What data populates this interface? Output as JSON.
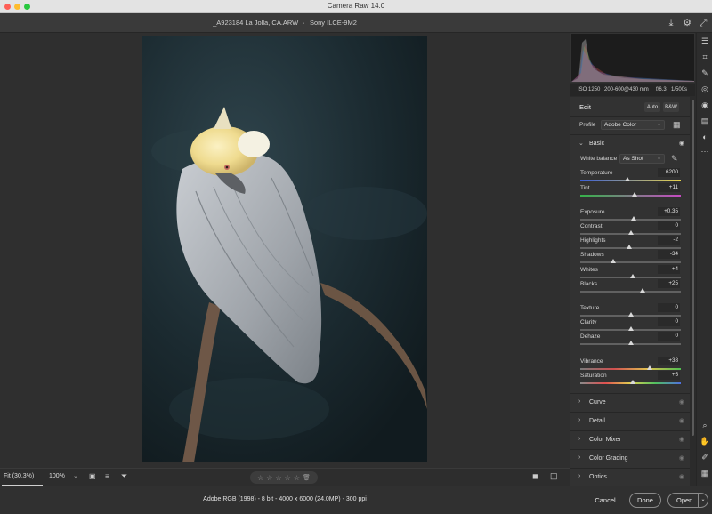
{
  "window": {
    "title": "Camera Raw 14.0"
  },
  "file": {
    "name": "_A923184 La Jolla, CA.ARW",
    "separator": "·",
    "camera": "Sony ILCE-9M2"
  },
  "histogram": {
    "colors": [
      "#e05050",
      "#50c070",
      "#5070e0"
    ]
  },
  "camera_info": {
    "iso": "ISO 1250",
    "lens": "200-600@430 mm",
    "aperture": "f/6.3",
    "shutter": "1/500s"
  },
  "edit": {
    "title": "Edit",
    "auto_label": "Auto",
    "bw_label": "B&W",
    "profile_label": "Profile",
    "profile_value": "Adobe Color",
    "basic": {
      "title": "Basic",
      "white_balance_label": "White balance",
      "white_balance_value": "As Shot",
      "sliders": [
        {
          "label": "Temperature",
          "value": "6200",
          "pos": 0.47
        },
        {
          "label": "Tint",
          "value": "+11",
          "pos": 0.54
        },
        {
          "label": "Exposure",
          "value": "+0.35",
          "pos": 0.53
        },
        {
          "label": "Contrast",
          "value": "0",
          "pos": 0.5
        },
        {
          "label": "Highlights",
          "value": "-2",
          "pos": 0.49
        },
        {
          "label": "Shadows",
          "value": "-34",
          "pos": 0.33
        },
        {
          "label": "Whites",
          "value": "+4",
          "pos": 0.52
        },
        {
          "label": "Blacks",
          "value": "+25",
          "pos": 0.62
        },
        {
          "label": "Texture",
          "value": "0",
          "pos": 0.5
        },
        {
          "label": "Clarity",
          "value": "0",
          "pos": 0.5
        },
        {
          "label": "Dehaze",
          "value": "0",
          "pos": 0.5
        },
        {
          "label": "Vibrance",
          "value": "+38",
          "pos": 0.69
        },
        {
          "label": "Saturation",
          "value": "+5",
          "pos": 0.52
        }
      ]
    },
    "sections": [
      "Curve",
      "Detail",
      "Color Mixer",
      "Color Grading",
      "Optics"
    ]
  },
  "bottom_bar": {
    "fit_label": "Fit (30.3%)",
    "zoom_value": "100%"
  },
  "footer": {
    "workflow_link": "Adobe RGB (1998) - 8 bit - 4000 x 6000 (24.0MP) - 300 ppi",
    "cancel": "Cancel",
    "done": "Done",
    "open": "Open"
  }
}
